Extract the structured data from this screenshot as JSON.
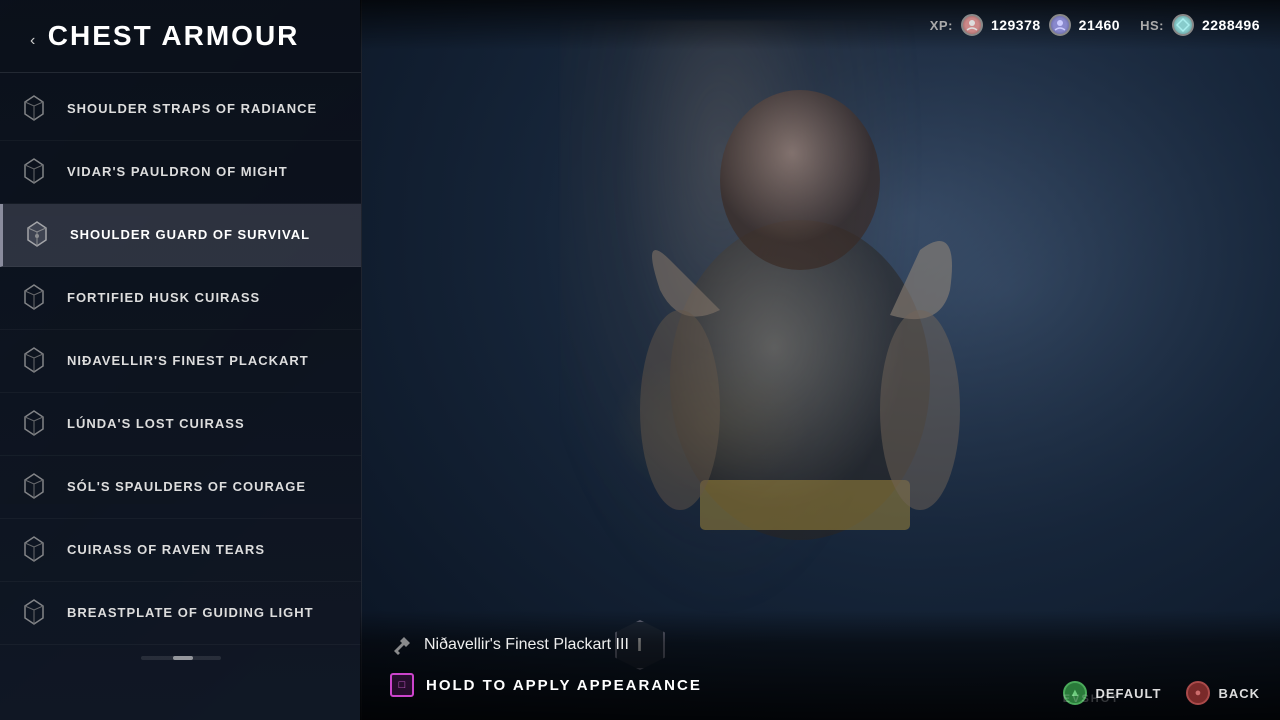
{
  "header": {
    "title": "CHEST ARMOUR",
    "back_arrow": "‹"
  },
  "hud": {
    "xp_label": "XP:",
    "kratos_xp": "129378",
    "atreus_xp": "21460",
    "hs_label": "HS:",
    "hs_value": "2288496"
  },
  "armour_items": [
    {
      "id": 1,
      "name": "SHOULDER STRAPS OF RADIANCE",
      "selected": false
    },
    {
      "id": 2,
      "name": "VIDAR'S PAULDRON OF MIGHT",
      "selected": false
    },
    {
      "id": 3,
      "name": "SHOULDER GUARD OF SURVIVAL",
      "selected": true
    },
    {
      "id": 4,
      "name": "FORTIFIED HUSK CUIRASS",
      "selected": false
    },
    {
      "id": 5,
      "name": "NIÐAVELLIR'S FINEST PLACKART",
      "selected": false
    },
    {
      "id": 6,
      "name": "LÚNDA'S LOST CUIRASS",
      "selected": false
    },
    {
      "id": 7,
      "name": "SÓL'S SPAULDERS OF COURAGE",
      "selected": false
    },
    {
      "id": 8,
      "name": "CUIRASS OF RAVEN TEARS",
      "selected": false
    },
    {
      "id": 9,
      "name": "BREASTPLATE OF GUIDING LIGHT",
      "selected": false
    }
  ],
  "preview": {
    "item_name": "Niðavellir's Finest Plackart III",
    "action_label": "HOLD TO APPLY APPEARANCE",
    "action_button": "□",
    "numeral": "I"
  },
  "controls": {
    "default_label": "DEFAULT",
    "back_label": "BACK"
  },
  "watermark": "EVSHOT",
  "deco_text": "NIÐAVELLIR'S FINEST PLACKART"
}
